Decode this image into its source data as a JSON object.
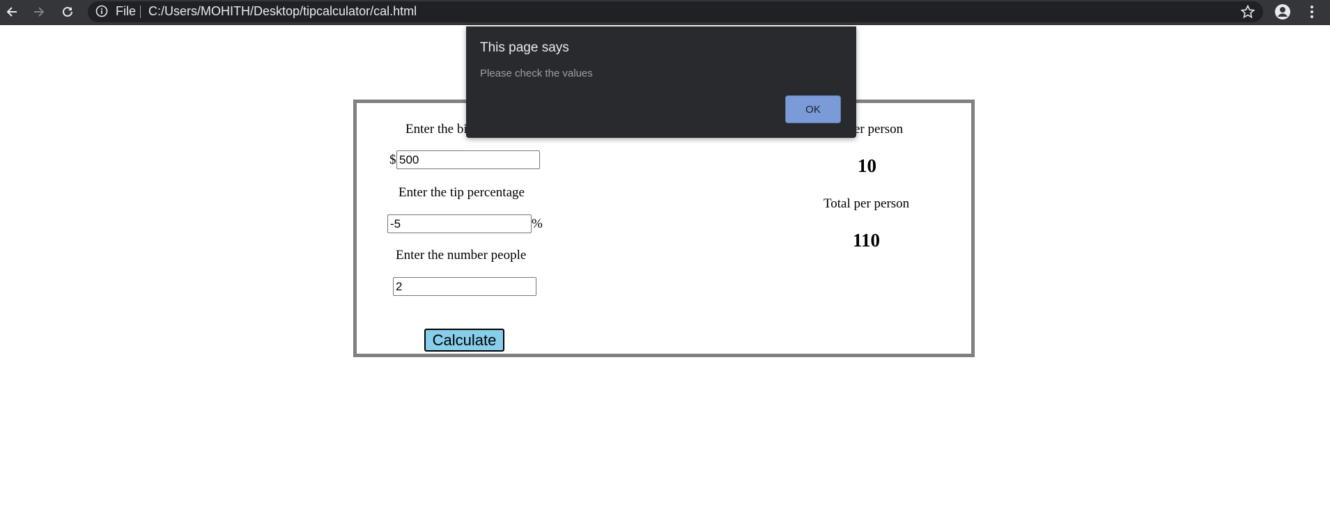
{
  "browser": {
    "omnibox_scheme": "File",
    "url": "C:/Users/MOHITH/Desktop/tipcalculator/cal.html",
    "icons": {
      "back": "back-arrow-icon",
      "forward": "forward-arrow-icon",
      "reload": "reload-icon",
      "info": "info-icon",
      "star": "star-icon",
      "profile": "profile-icon",
      "menu": "more-vert-icon"
    }
  },
  "calculator": {
    "bill_label": "Enter the bill amount",
    "currency_symbol": "$",
    "bill_value": "500",
    "tip_label": "Enter the tip percentage",
    "tip_value": "-5",
    "percent_symbol": "%",
    "people_label": "Enter the number people",
    "people_value": "2",
    "calculate_label": "Calculate",
    "tip_per_person_label": "Tip per person",
    "tip_per_person_value": "10",
    "total_per_person_label": "Total per person",
    "total_per_person_value": "110"
  },
  "dialog": {
    "title": "This page says",
    "message": "Please check the values",
    "ok_label": "OK"
  },
  "colors": {
    "toolbar_bg": "#35363a",
    "omnibox_bg": "#202124",
    "dialog_bg": "#292a2d",
    "ok_button": "#7a9bd8",
    "calculate_button": "#87ceeb",
    "panel_border": "#808080"
  }
}
